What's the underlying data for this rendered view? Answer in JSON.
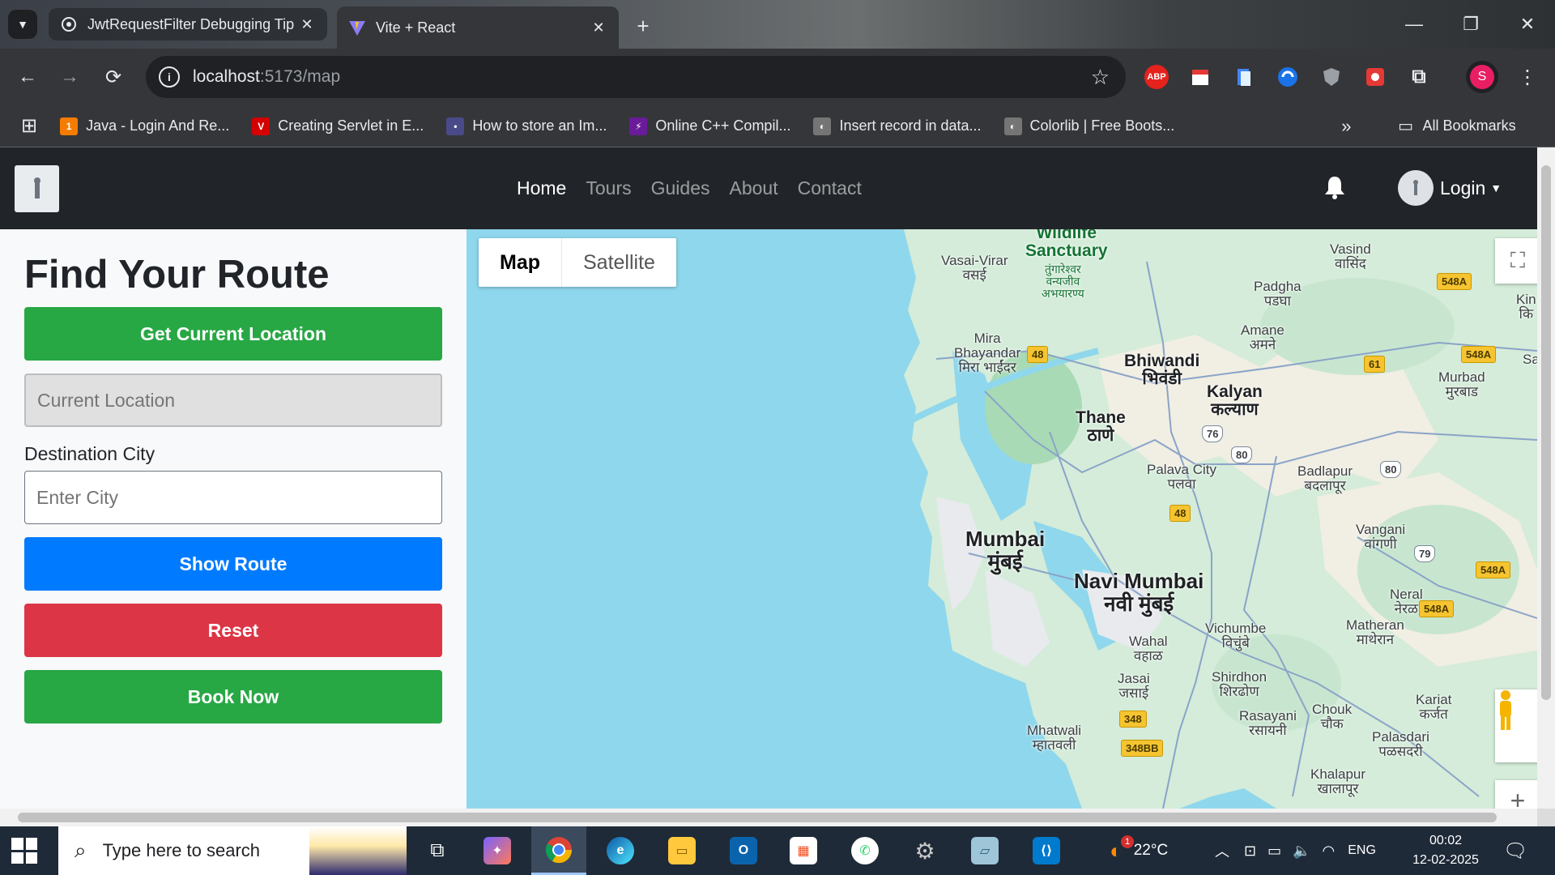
{
  "browser": {
    "tabs": [
      {
        "title": "JwtRequestFilter Debugging Tip",
        "active": false
      },
      {
        "title": "Vite + React",
        "active": true
      }
    ],
    "url_host": "localhost",
    "url_path": ":5173/map",
    "profile_initial": "S",
    "extensions": [
      "ABP"
    ],
    "bookmarks": [
      {
        "label": "Java - Login And Re...",
        "icon": "1"
      },
      {
        "label": "Creating Servlet in E...",
        "icon": "V"
      },
      {
        "label": "How to store an Im...",
        "icon": "•"
      },
      {
        "label": "Online C++ Compil...",
        "icon": "⚡"
      },
      {
        "label": "Insert record in data...",
        "icon": "◐"
      },
      {
        "label": "Colorlib | Free Boots...",
        "icon": "◐"
      }
    ],
    "all_bookmarks": "All Bookmarks"
  },
  "navbar": {
    "links": [
      "Home",
      "Tours",
      "Guides",
      "About",
      "Contact"
    ],
    "login_label": "Login"
  },
  "sidebar": {
    "title": "Find Your Route",
    "get_location_label": "Get Current Location",
    "current_location_placeholder": "Current Location",
    "destination_label": "Destination City",
    "destination_placeholder": "Enter City",
    "show_route_label": "Show Route",
    "reset_label": "Reset",
    "book_now_label": "Book Now"
  },
  "map": {
    "type_options": [
      "Map",
      "Satellite"
    ],
    "selected_type": "Map",
    "labels": {
      "wildlife": "Wildlife",
      "sanctuary": "Sanctuary",
      "tungareshwar_mr1": "तुंगारेश्वर",
      "tungareshwar_mr2": "वन्यजीव",
      "tungareshwar_mr3": "अभयारण्य",
      "vasai": "Vasai-Virar",
      "vasai_mr": "वसई",
      "vasind": "Vasind",
      "vasind_mr": "वासिंद",
      "padgha": "Padgha",
      "padgha_mr": "पडघा",
      "amane": "Amane",
      "amane_mr": "अमने",
      "mira": "Mira",
      "bhayandar": "Bhayandar",
      "bhayandar_mr": "मिरा भाईंदर",
      "bhiwandi": "Bhiwandi",
      "bhiwandi_mr": "भिवंडी",
      "kalyan": "Kalyan",
      "kalyan_mr": "कल्याण",
      "murbad": "Murbad",
      "murbad_mr": "मुरबाड",
      "thane": "Thane",
      "thane_mr": "ठाणे",
      "palava": "Palava City",
      "palava_mr": "पलवा",
      "badlapur": "Badlapur",
      "badlapur_mr": "बदलापूर",
      "mumbai": "Mumbai",
      "mumbai_mr": "मुंबई",
      "navi_mumbai": "Navi Mumbai",
      "navi_mumbai_mr": "नवी मुंबई",
      "vangani": "Vangani",
      "vangani_mr": "वांगणी",
      "neral": "Neral",
      "neral_mr": "नेरळ",
      "vichumbe": "Vichumbe",
      "vichumbe_mr": "विचुंबे",
      "wahal": "Wahal",
      "wahal_mr": "वहाळ",
      "matheran": "Matheran",
      "matheran_mr": "माथेरान",
      "jasai": "Jasai",
      "jasai_mr": "जसाई",
      "shirdhon": "Shirdhon",
      "shirdhon_mr": "शिरढोण",
      "kariat": "Kariat",
      "kariat_mr": "कर्जत",
      "rasayani": "Rasayani",
      "rasayani_mr": "रसायनी",
      "chouk": "Chouk",
      "chouk_mr": "चौक",
      "mhatwali": "Mhatwali",
      "mhatwali_mr": "म्हातवली",
      "palasdari": "Palasdari",
      "palasdari_mr": "पळसदरी",
      "khalapur": "Khalapur",
      "khalapur_mr": "खालापूर",
      "kin": "Kin",
      "kin_mr": "कि",
      "sa": "Sa"
    },
    "shields": [
      "548A",
      "548A",
      "548A",
      "548A",
      "48",
      "61",
      "76",
      "80",
      "80",
      "48",
      "79",
      "348",
      "348BB"
    ]
  },
  "taskbar": {
    "search_placeholder": "Type here to search",
    "weather": "22°C",
    "weather_badge": "1",
    "language": "ENG",
    "time": "00:02",
    "date": "12-02-2025"
  }
}
